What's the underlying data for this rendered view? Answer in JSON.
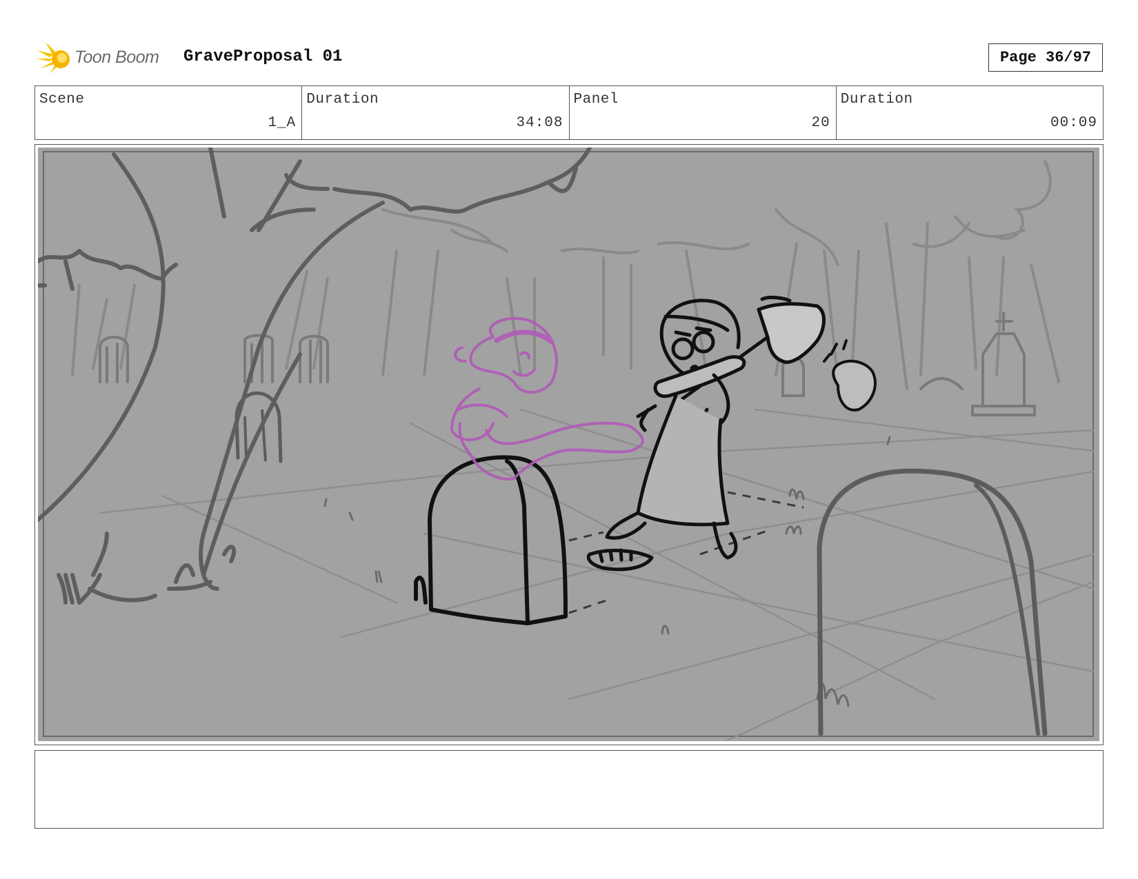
{
  "header": {
    "logo_text": "Toon Boom",
    "title": "GraveProposal 01",
    "page_label": "Page 36/97"
  },
  "info": [
    {
      "label": "Scene",
      "value": "1_A"
    },
    {
      "label": "Duration",
      "value": "34:08"
    },
    {
      "label": "Panel",
      "value": "20"
    },
    {
      "label": "Duration",
      "value": "00:09"
    }
  ],
  "colors": {
    "panel_background": "#a2a2a2",
    "ghost_outline": "#b05ab8",
    "logo_star": "#f5c400"
  },
  "notes": {
    "text": ""
  }
}
